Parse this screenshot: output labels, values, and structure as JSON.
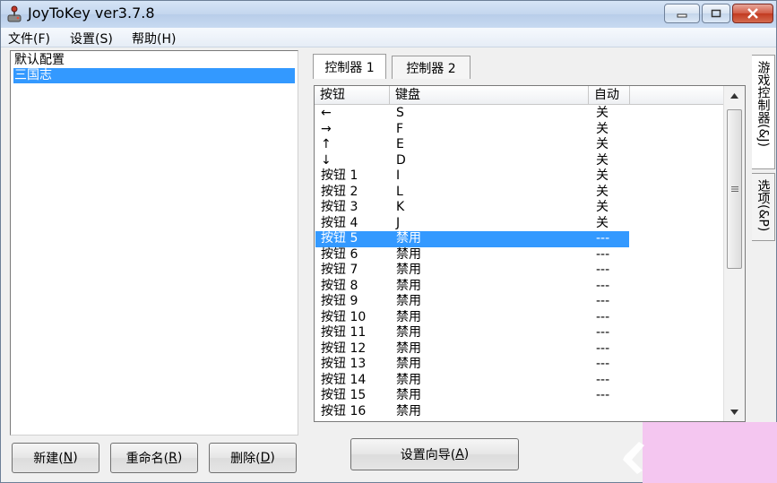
{
  "window": {
    "title": "JoyToKey ver3.7.8",
    "min_glyph": "▁",
    "max_glyph": "□",
    "close_glyph": "✕"
  },
  "menu": [
    {
      "label": "文件(F)"
    },
    {
      "label": "设置(S)"
    },
    {
      "label": "帮助(H)"
    }
  ],
  "profiles": {
    "items": [
      {
        "label": "默认配置",
        "selected": false
      },
      {
        "label": "三国志",
        "selected": true
      }
    ]
  },
  "left_buttons": {
    "new": {
      "text": "新建(",
      "key": "N",
      "end": ")"
    },
    "rename": {
      "text": "重命名(",
      "key": "R",
      "end": ")"
    },
    "delete": {
      "text": "删除(",
      "key": "D",
      "end": ")"
    }
  },
  "tabs": [
    {
      "label": "控制器 1",
      "active": true
    },
    {
      "label": "控制器 2",
      "active": false
    }
  ],
  "side_tabs": [
    {
      "label": "游戏控制器(&J)",
      "active": true
    },
    {
      "label": "选项(&P)",
      "active": false
    }
  ],
  "grid": {
    "columns": [
      "按钮",
      "键盘",
      "自动"
    ],
    "rows": [
      {
        "button": "←",
        "key": "S",
        "auto": "关"
      },
      {
        "button": "→",
        "key": "F",
        "auto": "关"
      },
      {
        "button": "↑",
        "key": "E",
        "auto": "关"
      },
      {
        "button": "↓",
        "key": "D",
        "auto": "关"
      },
      {
        "button": "按钮 1",
        "key": "I",
        "auto": "关"
      },
      {
        "button": "按钮 2",
        "key": "L",
        "auto": "关"
      },
      {
        "button": "按钮 3",
        "key": "K",
        "auto": "关"
      },
      {
        "button": "按钮 4",
        "key": "J",
        "auto": "关"
      },
      {
        "button": "按钮 5",
        "key": "禁用",
        "auto": "---",
        "selected": true
      },
      {
        "button": "按钮 6",
        "key": "禁用",
        "auto": "---"
      },
      {
        "button": "按钮 7",
        "key": "禁用",
        "auto": "---"
      },
      {
        "button": "按钮 8",
        "key": "禁用",
        "auto": "---"
      },
      {
        "button": "按钮 9",
        "key": "禁用",
        "auto": "---"
      },
      {
        "button": "按钮 10",
        "key": "禁用",
        "auto": "---"
      },
      {
        "button": "按钮 11",
        "key": "禁用",
        "auto": "---"
      },
      {
        "button": "按钮 12",
        "key": "禁用",
        "auto": "---"
      },
      {
        "button": "按钮 13",
        "key": "禁用",
        "auto": "---"
      },
      {
        "button": "按钮 14",
        "key": "禁用",
        "auto": "---"
      },
      {
        "button": "按钮 15",
        "key": "禁用",
        "auto": "---"
      },
      {
        "button": "按钮 16",
        "key": "禁用",
        "auto": ""
      }
    ]
  },
  "wizard_button": {
    "text": "设置向导(",
    "key": "A",
    "end": ")"
  },
  "colors": {
    "selection": "#3399ff",
    "window_bg": "#f0f0f0",
    "watermark_bg": "#f4c6f0"
  }
}
